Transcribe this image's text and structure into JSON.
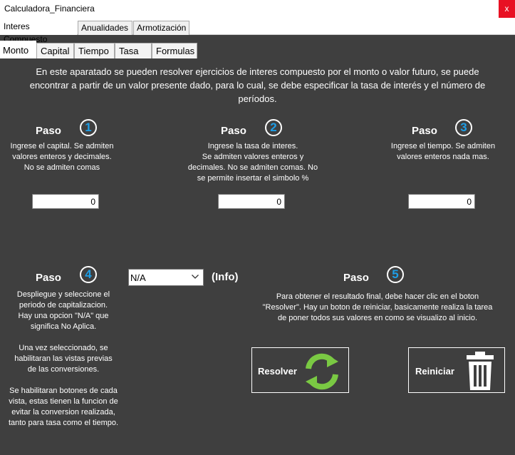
{
  "window": {
    "title": "Calculadora_Financiera",
    "close_glyph": "x"
  },
  "main_tabs": [
    {
      "label": "Interes Compuesto",
      "active": true
    },
    {
      "label": "Anualidades",
      "active": false
    },
    {
      "label": "Armotización",
      "active": false
    }
  ],
  "sub_tabs": [
    {
      "label": "Monto",
      "active": true
    },
    {
      "label": "Capital",
      "active": false
    },
    {
      "label": "Tiempo",
      "active": false
    },
    {
      "label": "Tasa",
      "active": false
    },
    {
      "label": "Formulas",
      "active": false
    }
  ],
  "intro": {
    "line1": "En este aparatado se pueden resolver ejercicios de interes compuesto por el monto o valor futuro, se puede",
    "line2": "encontrar a partir de un valor presente dado, para lo cual, se debe especificar la tasa de interés  y el número de",
    "line3": "períodos."
  },
  "steps": [
    {
      "title": "Paso",
      "number": "1",
      "lines": [
        "Ingrese el capital. Se admiten",
        "valores enteros y decimales.",
        "No se admiten comas"
      ],
      "input_value": "0"
    },
    {
      "title": "Paso",
      "number": "2",
      "lines": [
        "Ingrese la tasa de interes.",
        "Se admiten valores enteros y",
        "decimales. No se admiten comas. No",
        "se permite insertar el simbolo %"
      ],
      "input_value": "0"
    },
    {
      "title": "Paso",
      "number": "3",
      "lines": [
        "Ingrese el tiempo. Se admiten",
        "valores enteros nada mas."
      ],
      "input_value": "0"
    },
    {
      "title": "Paso",
      "number": "4",
      "lines": [
        "Despliegue y seleccione el",
        "periodo de capitalizacion.",
        "Hay una opcion  \"N/A\" que",
        "significa No Aplica.",
        "",
        "Una vez seleccionado, se",
        "habilitaran las vistas previas",
        "de las conversiones.",
        "",
        "Se habilitaran botones de cada",
        "vista, estas tienen la funcion de",
        "evitar la conversion realizada,",
        "tanto para tasa como el tiempo."
      ]
    },
    {
      "title": "Paso",
      "number": "5",
      "lines": [
        "Para obtener el resultado final, debe hacer clic en el boton",
        "\"Resolver\". Hay un boton de reiniciar, basicamente realiza la tarea",
        "de poner todos sus valores en como se visualizo al inicio."
      ]
    }
  ],
  "period_select": {
    "value": "N/A"
  },
  "info_label": "(Info)",
  "buttons": {
    "resolver": "Resolver",
    "reiniciar": "Reiniciar"
  },
  "colors": {
    "background": "#3f3f3f",
    "accent": "#1e9ee6",
    "refresh_green": "#7ac943",
    "close_red": "#e81123"
  },
  "icons": {
    "refresh": "refresh-icon",
    "trash": "trash-icon",
    "dropdown": "chevron-down-icon"
  }
}
